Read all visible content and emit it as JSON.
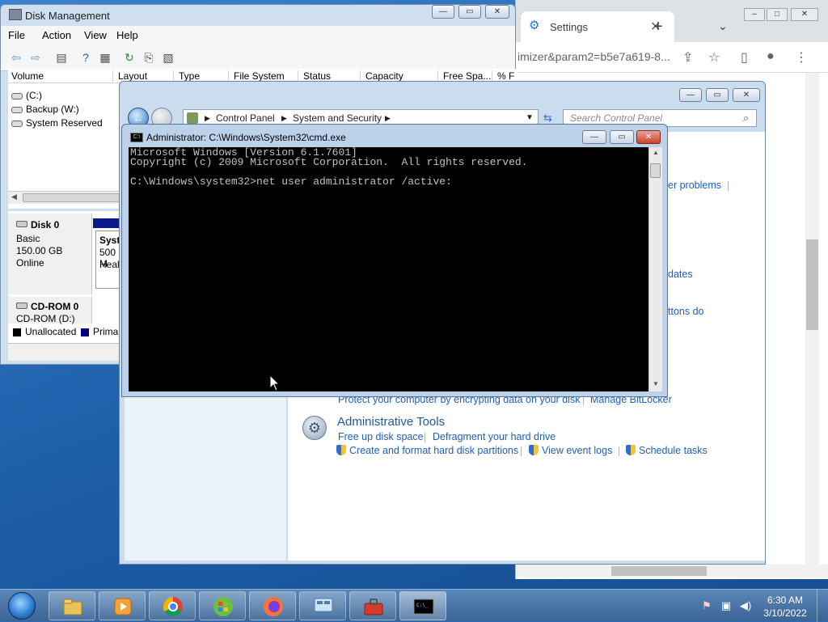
{
  "colors": {
    "desktop": "#2b6ab6",
    "console_bg": "#000000",
    "console_fg": "#c0c0c0",
    "link": "#1f5fb8",
    "heading": "#1e5a99",
    "unallocated_swatch": "#000000",
    "primary_swatch": "#000080"
  },
  "chrome": {
    "tab_title": "Settings",
    "tab_icon": "gear-icon",
    "url": "imizer&param2=b5e7a619-8..."
  },
  "disk_management": {
    "title": "Disk Management",
    "menu": [
      "File",
      "Action",
      "View",
      "Help"
    ],
    "columns": [
      "Volume",
      "Layout",
      "Type",
      "File System",
      "Status",
      "Capacity",
      "Free Spa...",
      "% F"
    ],
    "volumes": [
      "(C:)",
      "Backup (W:)",
      "System Reserved"
    ],
    "disk0": {
      "name": "Disk 0",
      "type": "Basic",
      "size": "150.00 GB",
      "status": "Online",
      "partition_label": "Syste",
      "partition_size": "500 M",
      "partition_status": "Heal"
    },
    "cdrom0": {
      "name": "CD-ROM 0",
      "drive": "CD-ROM (D:)"
    },
    "legend": [
      "Unallocated",
      "Prima"
    ]
  },
  "control_panel": {
    "breadcrumbs": [
      "Control Panel",
      "System and Security"
    ],
    "search_placeholder": "Search Control Panel",
    "partial_links": [
      "er problems",
      "dates",
      "ttons do"
    ],
    "bitlocker_link": "Protect your computer by encrypting data on your disk",
    "bitlocker_manage": "Manage BitLocker",
    "admin_tools": {
      "heading": "Administrative Tools",
      "links": [
        "Free up disk space",
        "Defragment your hard drive"
      ],
      "shield_links": [
        "Create and format hard disk partitions",
        "View event logs",
        "Schedule tasks"
      ]
    }
  },
  "cmd": {
    "title": "Administrator: C:\\Windows\\System32\\cmd.exe",
    "title_icon_text": "C:\\",
    "lines": [
      "Microsoft Windows [Version 6.1.7601]",
      "Copyright (c) 2009 Microsoft Corporation.  All rights reserved.",
      "",
      "C:\\Windows\\system32>net user administrator /active:"
    ]
  },
  "taskbar": {
    "apps": [
      "windows-explorer-icon",
      "media-player-icon",
      "chrome-icon",
      "windows-live-icon",
      "firefox-icon",
      "network-settings-icon",
      "toolbox-icon",
      "cmd-icon"
    ],
    "time": "6:30 AM",
    "date": "3/10/2022"
  }
}
